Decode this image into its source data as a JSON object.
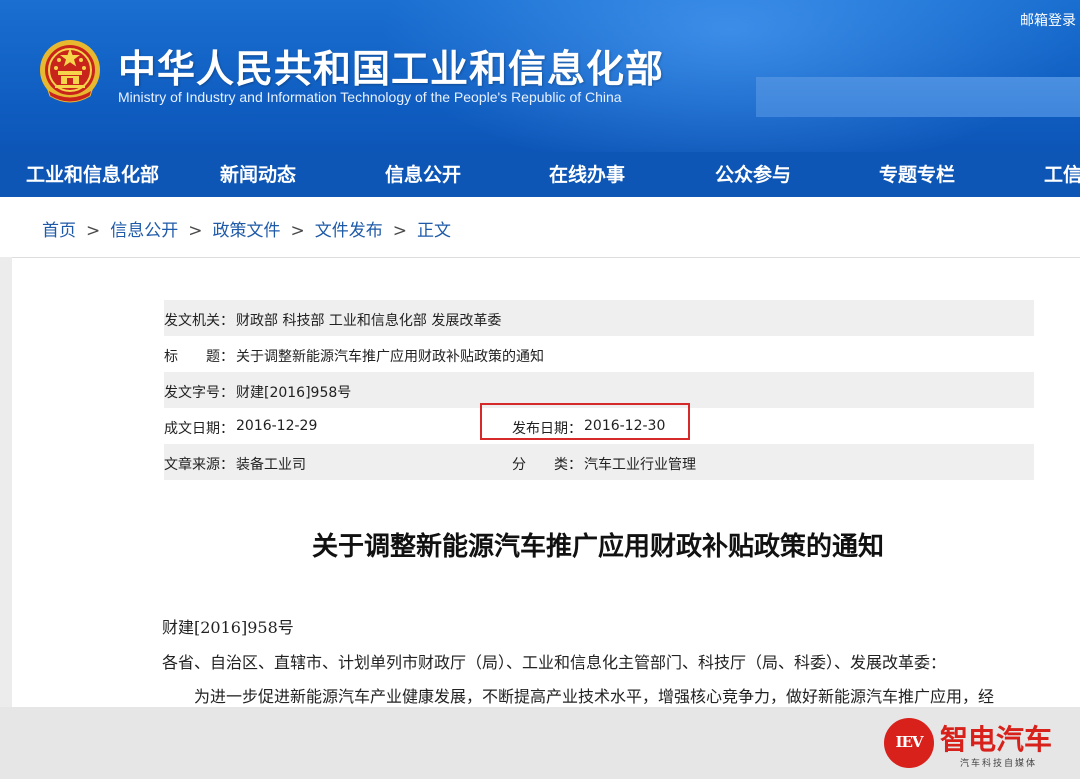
{
  "header": {
    "site_title": "中华人民共和国工业和信息化部",
    "site_subtitle": "Ministry of Industry and Information Technology of the People's Republic of China",
    "mail_login": "邮箱登录",
    "emblem_icon": "national-emblem-icon",
    "brand_color": "#0f5cc0"
  },
  "nav": {
    "items": [
      {
        "label": "工业和信息化部"
      },
      {
        "label": "新闻动态"
      },
      {
        "label": "信息公开"
      },
      {
        "label": "在线办事"
      },
      {
        "label": "公众参与"
      },
      {
        "label": "专题专栏"
      },
      {
        "label": "工信"
      }
    ]
  },
  "breadcrumb": {
    "items": [
      "首页",
      "信息公开",
      "政策文件",
      "文件发布",
      "正文"
    ],
    "separator": ">"
  },
  "info": {
    "issuer_label": "发文机关：",
    "issuer": "财政部 科技部 工业和信息化部 发展改革委",
    "title_label": "标　　题：",
    "title": "关于调整新能源汽车推广应用财政补贴政策的通知",
    "doc_no_label": "发文字号：",
    "doc_no": "财建[2016]958号",
    "created_label": "成文日期：",
    "created": "2016-12-29",
    "published_label": "发布日期：",
    "published": "2016-12-30",
    "source_label": "文章来源：",
    "source": "装备工业司",
    "category_label": "分　　类：",
    "category": "汽车工业行业管理",
    "highlight_color": "#d62a2a"
  },
  "document": {
    "title": "关于调整新能源汽车推广应用财政补贴政策的通知",
    "doc_no": "财建[2016]958号",
    "addressees": "各省、自治区、直辖市、计划单列市财政厅（局）、工业和信息化主管部门、科技厅（局、科委）、发展改革委：",
    "paragraph_1": "为进一步促进新能源汽车产业健康发展，不断提高产业技术水平，增强核心竞争力，做好新能源汽车推广应用，经"
  },
  "watermark": {
    "logo_text": "IEV",
    "name": "智电汽车",
    "slogan": "汽车科技自媒体",
    "color": "#d7211a"
  }
}
